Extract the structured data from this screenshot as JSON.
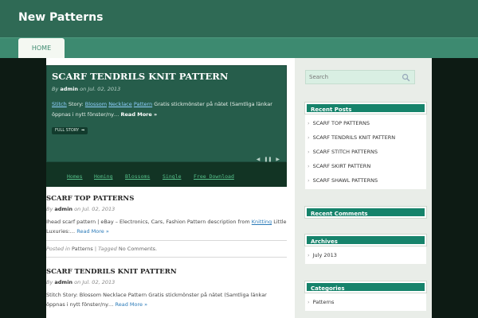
{
  "site": {
    "title": "New Patterns"
  },
  "nav": {
    "home": "HOME"
  },
  "featured": {
    "title": "SCARF TENDRILS KNIT PATTERN",
    "meta_by": "By",
    "author": "admin",
    "meta_on": "on",
    "date": "Jul. 02, 2013",
    "links": [
      "Stitch",
      "Blossom",
      "Necklace",
      "Pattern"
    ],
    "story_label": "Story:",
    "text": "Gratis stickmönster på nätet (Samtliga länkar öppnas i nytt fönster/ny…",
    "read_more": "Read More »",
    "full_story": "FULL STORY",
    "strip_links": [
      "Homes",
      "Homing",
      "Blossoms",
      "Single",
      "Free Download"
    ]
  },
  "posts": [
    {
      "title": "SCARF TOP PATTERNS",
      "meta_by": "By",
      "author": "admin",
      "meta_on": "on",
      "date": "Jul. 02, 2013",
      "excerpt_before": "Ihead scarf pattern | eBay – Electronics, Cars, Fashion Pattern description from",
      "excerpt_link": "Knitting",
      "excerpt_after": "Little Luxuries:…",
      "read_more": "Read More »",
      "posted_in": "Posted in",
      "category": "Patterns",
      "tagged": "| Tagged",
      "comments": "No Comments."
    },
    {
      "title": "SCARF TENDRILS KNIT PATTERN",
      "meta_by": "By",
      "author": "admin",
      "meta_on": "on",
      "date": "Jul. 02, 2013",
      "excerpt": "Stitch Story: Blossom Necklace Pattern Gratis stickmönster på nätet (Samtliga länkar öppnas i nytt fönster/ny…",
      "read_more": "Read More »"
    }
  ],
  "sidebar": {
    "search_placeholder": "Search",
    "recent_posts": {
      "title": "Recent Posts",
      "items": [
        "SCARF TOP PATTERNS",
        "SCARF TENDRILS KNIT PATTERN",
        "SCARF STITCH PATTERNS",
        "SCARF SKIRT PATTERN",
        "SCARF SHAWL PATTERNS"
      ]
    },
    "recent_comments": {
      "title": "Recent Comments"
    },
    "archives": {
      "title": "Archives",
      "items": [
        "July 2013"
      ]
    },
    "categories": {
      "title": "Categories",
      "items": [
        "Patterns"
      ]
    }
  },
  "colors": {
    "header": "#2f6a55",
    "nav": "#3d8a70",
    "widget_head": "#16836b",
    "featured_bg": "#265d4b"
  },
  "icons": {
    "search": "magnifier-icon",
    "arrow": "right-arrow-icon"
  }
}
